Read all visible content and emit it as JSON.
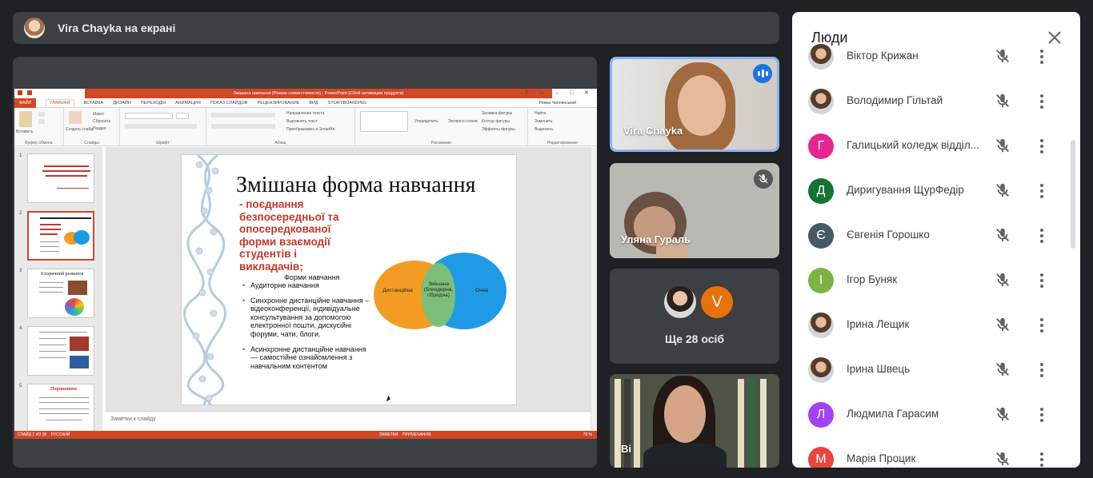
{
  "presenter_bar": {
    "title": "Vira Chayka на екрані"
  },
  "powerpoint": {
    "window_title": "Змішана навчання [Режим совместимости] - PowerPoint (Сбой активации продукта)",
    "tabs": [
      "ФАЙЛ",
      "ГЛАВНАЯ",
      "ВСТАВКА",
      "ДИЗАЙН",
      "ПЕРЕХОДЫ",
      "АНИМАЦИЯ",
      "ПОКАЗ СЛАЙДОВ",
      "РЕЦЕНЗИРОВАНИЕ",
      "ВИД",
      "STORYBOARDING"
    ],
    "active_tab": "ГЛАВНАЯ",
    "user": "Роман Чаплинський",
    "ribbon_groups": {
      "clipboard": "Буфер обмена",
      "slides": "Слайды",
      "font": "Шрифт",
      "paragraph": "Абзац",
      "drawing": "Рисование",
      "editing": "Редактирование"
    },
    "ribbon_buttons": {
      "paste": "Вставить",
      "create_slide": "Создать слайд",
      "layout": "Макет",
      "reset": "Сбросить",
      "section": "Раздел",
      "text_direction": "Направление текста",
      "align_text": "Выровнять текст",
      "smartart": "Преобразовать в SmartArt",
      "arrange": "Упорядочить",
      "quick_styles": "Экспресс-стили",
      "shape_fill": "Заливка фигуры",
      "shape_outline": "Контур фигуры",
      "shape_effects": "Эффекты фигуры",
      "find": "Найти",
      "replace": "Заменить",
      "select": "Выделить"
    },
    "slide_numbers": [
      "1",
      "2",
      "3",
      "4",
      "5"
    ],
    "active_slide": "2",
    "thumb_titles": {
      "s3": "Історичний розвиток",
      "s5": "Порівняння"
    },
    "notes_placeholder": "Заметки к слайду",
    "status": {
      "slide_of": "СЛАЙД 2 ИЗ 18",
      "language": "РУССКИЙ",
      "notes": "ЗАМЕТКИ",
      "comments": "ПРИМЕЧАНИЯ",
      "zoom": "79 %"
    }
  },
  "slide": {
    "title": "Змішана форма навчання",
    "subtitle": "- поєднання безпосередньої та опосередкованої форми взаємодії студентів і викладачів;",
    "forms_label": "Форми навчання",
    "bullets": [
      "Аудиторне навчання",
      "Синхронне дистанційне навчання – відеоконференції, індивідуальне консультування за допомогою електронної пошти, дискусійні форуми, чати, блоги.",
      "Асинхронне дистанційне навчання — самостійне ознайомлення з навчальним контентом"
    ],
    "venn": {
      "left": "Дистанційна",
      "middle": "Змішана (блендерна, гібридна)",
      "right": "Очна",
      "colors": {
        "left": "#f39c24",
        "right": "#1f9be6",
        "overlap": "#7cbf79"
      }
    }
  },
  "tiles": [
    {
      "name": "Vira Chayka",
      "speaking": true
    },
    {
      "name": "Уляна Гураль",
      "muted": true
    },
    {
      "more_label": "Ще 28 осіб",
      "avatar_letter": "V"
    },
    {
      "name": "Ві"
    }
  ],
  "people_panel": {
    "title": "Люди",
    "participants": [
      {
        "name": "Віктор Крижан",
        "avatar": "photo"
      },
      {
        "name": "Володимир Гільтай",
        "avatar": "photo"
      },
      {
        "name": "Галицький коледж відділ...",
        "letter": "Г",
        "color": "#e52592"
      },
      {
        "name": "Диригування ЩурФедір",
        "letter": "Д",
        "color": "#137333"
      },
      {
        "name": "Євгенія Горошко",
        "letter": "Є",
        "color": "#455a64"
      },
      {
        "name": "Ігор Буняк",
        "letter": "І",
        "color": "#7cb342"
      },
      {
        "name": "Ірина Лещик",
        "avatar": "photo"
      },
      {
        "name": "Ірина Швець",
        "avatar": "photo"
      },
      {
        "name": "Людмила Гарасим",
        "letter": "Л",
        "color": "#a142f4"
      },
      {
        "name": "Марія Процик",
        "letter": "М",
        "color": "#e8453c"
      }
    ]
  }
}
